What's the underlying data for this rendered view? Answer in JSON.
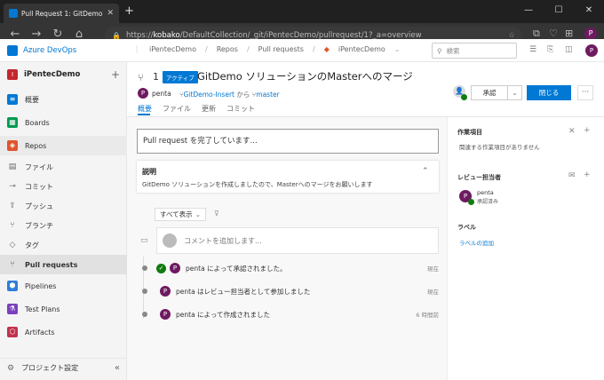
{
  "browser": {
    "tab_title": "Pull Request 1: GitDemo ソリュ...",
    "tab_close": "✕",
    "new_tab": "+",
    "url_host": "kobako",
    "url_prefix": "https://",
    "url_path": "/DefaultCollection/_git/iPentecDemo/pullrequest/1?_a=overview",
    "profile_initial": "P",
    "window_controls": [
      "—",
      "☐",
      "✕"
    ]
  },
  "header": {
    "brand": "Azure DevOps",
    "breadcrumbs": [
      "iPentecDemo",
      "Repos",
      "Pull requests",
      "iPentecDemo"
    ],
    "search_placeholder": "検索",
    "user_initial": "P"
  },
  "sidebar": {
    "project_name": "iPentecDemo",
    "project_initial": "I",
    "items": [
      {
        "label": "概要",
        "color": "#0078d4",
        "glyph": "≡"
      },
      {
        "label": "Boards",
        "color": "#009a52",
        "glyph": "▦"
      },
      {
        "label": "Repos",
        "color": "#e0542c",
        "glyph": "◈"
      },
      {
        "label": "ファイル",
        "glyph": "▤"
      },
      {
        "label": "コミット",
        "glyph": "⊸"
      },
      {
        "label": "プッシュ",
        "glyph": "⇪"
      },
      {
        "label": "ブランチ",
        "glyph": "⑂"
      },
      {
        "label": "タグ",
        "glyph": "◇"
      },
      {
        "label": "Pull requests",
        "glyph": "⑂"
      },
      {
        "label": "Pipelines",
        "color": "#2d7fd8",
        "glyph": "⬢"
      },
      {
        "label": "Test Plans",
        "color": "#7b3fbf",
        "glyph": "⚗"
      },
      {
        "label": "Artifacts",
        "color": "#c2324d",
        "glyph": "⬡"
      }
    ],
    "settings_label": "プロジェクト設定"
  },
  "pr": {
    "number": "1",
    "status": "アクティブ",
    "title": "GitDemo ソリューションのMasterへのマージ",
    "author": "penta",
    "author_initial": "P",
    "source_branch": "GitDemo-Insert",
    "from_text": "から",
    "target_branch": "master",
    "tabs": [
      "概要",
      "ファイル",
      "更新",
      "コミット"
    ],
    "approve_label": "承認",
    "complete_label": "閉じる",
    "more_label": "···"
  },
  "main": {
    "merge_status": "Pull request を完了しています...",
    "description_title": "説明",
    "description_text": "GitDemo ソリューションを作成しましたので、Masterへのマージをお願いします",
    "filter_label": "すべて表示",
    "comment_placeholder": "コメントを追加します...",
    "events": [
      {
        "text": "penta によって承認されました。",
        "time": "現在",
        "approved": true
      },
      {
        "text": "penta はレビュー担当者として参加しました",
        "time": "現在",
        "approved": false
      },
      {
        "text": "penta によって作成されました",
        "time": "6 時間前",
        "approved": false
      }
    ]
  },
  "right_panel": {
    "work_items_title": "作業項目",
    "work_items_empty": "関連する作業項目がありません",
    "reviewers_title": "レビュー担当者",
    "reviewer_name": "penta",
    "reviewer_status": "承認済み",
    "labels_title": "ラベル",
    "labels_add": "ラベルの追加"
  }
}
